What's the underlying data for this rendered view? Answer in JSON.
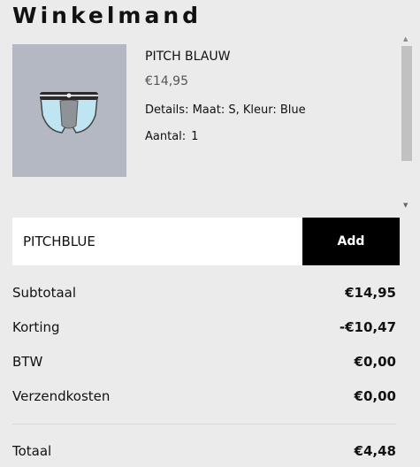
{
  "cart": {
    "title": "Winkelmand",
    "item": {
      "name": "PITCH BLAUW",
      "price": "€14,95",
      "details": "Details: Maat: S, Kleur: Blue",
      "qty_label": "Aantal:",
      "qty": "1"
    },
    "coupon": {
      "value": "PITCHBLUE",
      "button": "Add"
    },
    "summary": {
      "subtotal_label": "Subtotaal",
      "subtotal": "€14,95",
      "discount_label": "Korting",
      "discount": "-€10,47",
      "vat_label": "BTW",
      "vat": "€0,00",
      "shipping_label": "Verzendkosten",
      "shipping": "€0,00",
      "total_label": "Totaal",
      "total": "€4,48"
    }
  },
  "colors": {
    "background": "#ebebeb",
    "button": "#000000",
    "thumb_bg": "#b3b8c2"
  }
}
